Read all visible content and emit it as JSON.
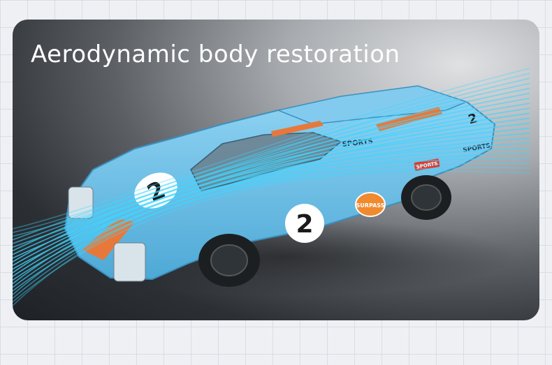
{
  "card": {
    "headline": "Aerodynamic body restoration"
  },
  "car": {
    "race_number": "2",
    "badge_text": "SURPASS",
    "side_text": "SPORTS",
    "decal_text": "SPORTS",
    "body_color": "#6fc3ec",
    "stripe_color": "#e8783a",
    "airflow_color": "#3fd6ff"
  }
}
